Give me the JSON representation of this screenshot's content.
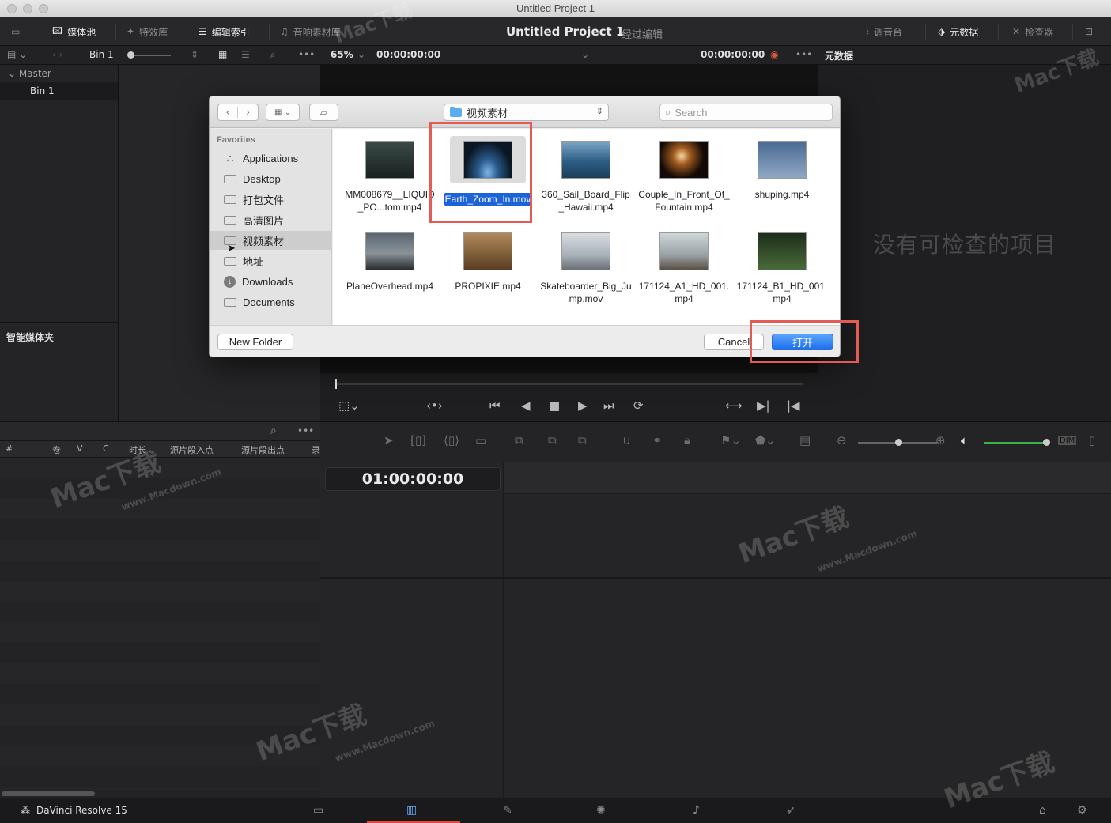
{
  "window": {
    "title": "Untitled Project 1"
  },
  "toolbar": {
    "media_pool": "媒体池",
    "effects": "特效库",
    "edit_index": "编辑索引",
    "sound_library": "音响素材库",
    "project_name": "Untitled Project 1",
    "mode": "经过编辑",
    "mixer": "调音台",
    "metadata": "元数据",
    "inspector": "检查器"
  },
  "subbar": {
    "bin_name": "Bin 1",
    "zoom": "65%",
    "source_timecode": "00:00:00:00",
    "record_timecode": "00:00:00:00",
    "metadata_title": "元数据"
  },
  "bins": {
    "master": "Master",
    "bin1": "Bin 1",
    "smart_bins": "智能媒体夹"
  },
  "inspector": {
    "empty_text": "没有可检查的项目"
  },
  "edit_index": {
    "columns": [
      "#",
      "卷",
      "V",
      "C",
      "时长",
      "源片段入点",
      "源片段出点",
      "录"
    ]
  },
  "timeline": {
    "timecode": "01:00:00:00"
  },
  "dialog": {
    "path": "视频素材",
    "search_placeholder": "Search",
    "favorites_label": "Favorites",
    "sidebar": [
      {
        "label": "Applications",
        "icon": "applications-icon"
      },
      {
        "label": "Desktop",
        "icon": "desktop-icon"
      },
      {
        "label": "打包文件",
        "icon": "folder-icon"
      },
      {
        "label": "高清图片",
        "icon": "folder-icon"
      },
      {
        "label": "视频素材",
        "icon": "folder-icon",
        "selected": true
      },
      {
        "label": "地址",
        "icon": "folder-icon"
      },
      {
        "label": "Downloads",
        "icon": "downloads-icon"
      },
      {
        "label": "Documents",
        "icon": "documents-icon"
      }
    ],
    "files": [
      {
        "name": "MM008679__LIQUID_PO...tom.mp4"
      },
      {
        "name": "Earth_Zoom_In.mov",
        "selected": true
      },
      {
        "name": "360_Sail_Board_Flip_Hawaii.mp4"
      },
      {
        "name": "Couple_In_Front_Of_Fountain.mp4"
      },
      {
        "name": "shuping.mp4"
      },
      {
        "name": "PlaneOverhead.mp4"
      },
      {
        "name": "PROPIXIE.mp4"
      },
      {
        "name": "Skateboarder_Big_Jump.mov"
      },
      {
        "name": "171124_A1_HD_001.mp4"
      },
      {
        "name": "171124_B1_HD_001.mp4"
      }
    ],
    "new_folder": "New Folder",
    "cancel": "Cancel",
    "open": "打开"
  },
  "bottombar": {
    "app_name": "DaVinci Resolve 15"
  },
  "watermark": {
    "text": "Mac下载",
    "url": "www.Macdown.com"
  },
  "colors": {
    "accent": "#1d63d8",
    "highlight": "#e25b54",
    "active_page": "#e0483a"
  }
}
